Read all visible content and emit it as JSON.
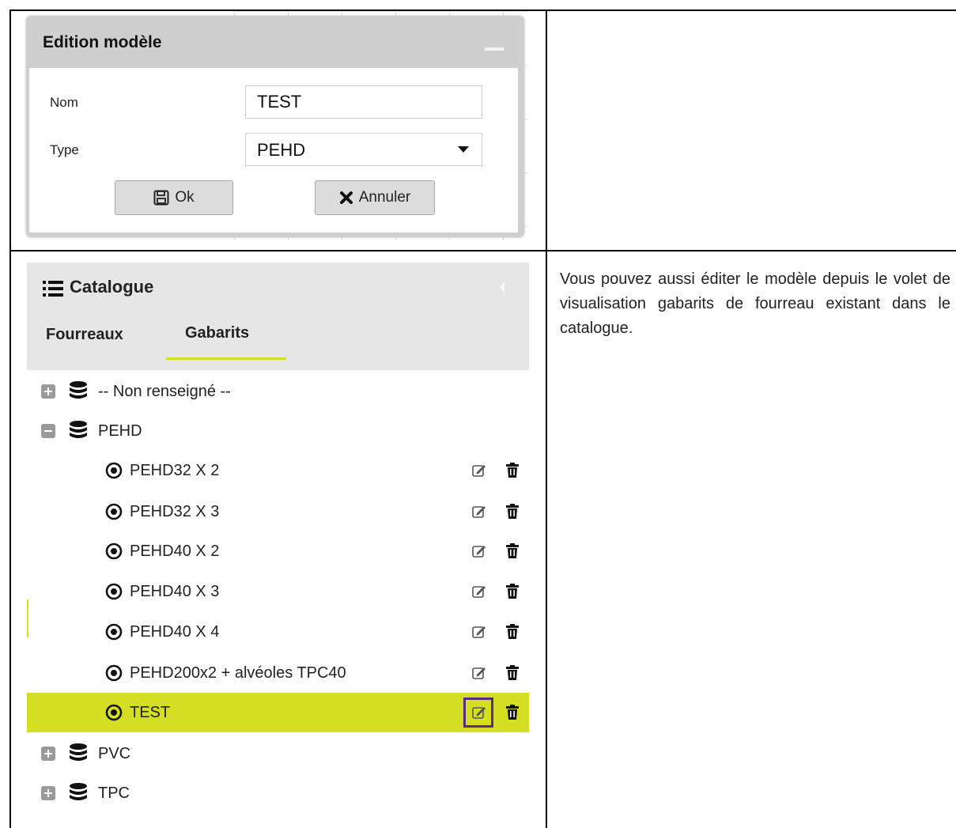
{
  "dialog": {
    "title": "Edition modèle",
    "name_label": "Nom",
    "name_value": "TEST",
    "type_label": "Type",
    "type_value": "PEHD",
    "ok_label": "Ok",
    "cancel_label": "Annuler"
  },
  "catalogue": {
    "title": "Catalogue",
    "tabs": [
      "Fourreaux",
      "Gabarits"
    ],
    "active_tab": "Gabarits",
    "tree": [
      {
        "label": "-- Non renseigné --",
        "expanded": false
      },
      {
        "label": "PEHD",
        "expanded": true
      },
      {
        "label": "PVC",
        "expanded": false
      },
      {
        "label": "TPC",
        "expanded": false
      }
    ],
    "pehd_items": [
      {
        "label": "PEHD32 X 2",
        "selected": false
      },
      {
        "label": "PEHD32 X 3",
        "selected": false
      },
      {
        "label": "PEHD40 X 2",
        "selected": false
      },
      {
        "label": "PEHD40 X 3",
        "selected": false
      },
      {
        "label": "PEHD40 X 4",
        "selected": false
      },
      {
        "label": "PEHD200x2 + alvéoles TPC40",
        "selected": false
      },
      {
        "label": "TEST",
        "selected": true
      }
    ]
  },
  "description": "Vous pouvez aussi éditer le modèle depuis le volet de visualisation gabarits de fourreau existant dans le catalogue.",
  "colors": {
    "accent": "#d4de23",
    "highlight_border": "#5b2a86",
    "panel_grey": "#e6e6e6",
    "dialog_grey": "#cfcfcf"
  }
}
